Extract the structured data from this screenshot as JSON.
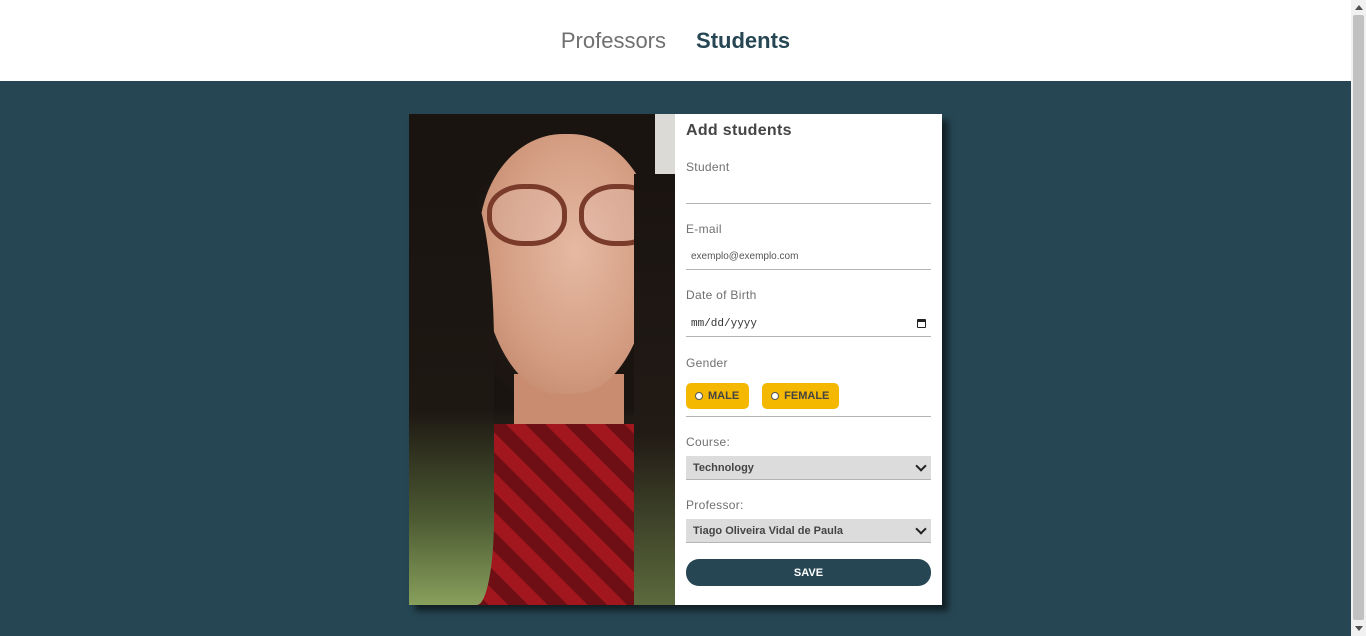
{
  "nav": {
    "professors_label": "Professors",
    "students_label": "Students",
    "active_tab": "Students"
  },
  "colors": {
    "brand_dark": "#264653",
    "accent_yellow": "#f5b800"
  },
  "form": {
    "title": "Add students",
    "student_label": "Student",
    "student_value": "",
    "email_label": "E-mail",
    "email_value": "exemplo@exemplo.com",
    "dob_label": "Date of Birth",
    "dob_placeholder": "mm/dd/yyyy",
    "gender_label": "Gender",
    "gender_options": [
      "MALE",
      "FEMALE"
    ],
    "course_label": "Course:",
    "course_value": "Technology",
    "professor_label": "Professor:",
    "professor_value": "Tiago Oliveira Vidal de Paula",
    "save_label": "SAVE"
  },
  "icons": {
    "calendar": "calendar-icon",
    "select_chevron": "chevron-down-icon",
    "radio": "radio-icon"
  }
}
